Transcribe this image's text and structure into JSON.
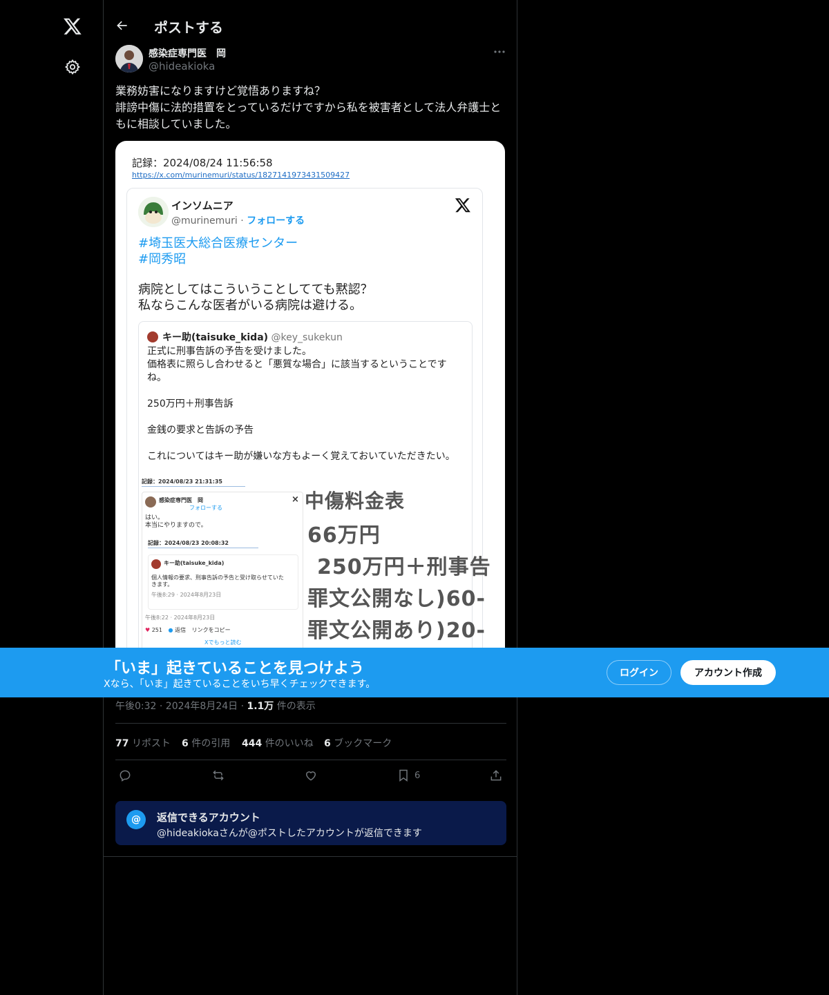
{
  "header": {
    "title": "ポストする"
  },
  "author": {
    "name": "感染症専門医　岡",
    "handle": "@hideakioka"
  },
  "tweet": {
    "text": "業務妨害になりますけど覚悟ありますね？\n誹謗中傷に法的措置をとっているだけですから私を被害者として法人弁護士ともに相談していました。"
  },
  "media": {
    "record": "記録：2024/08/24 11:56:58",
    "link": "https://x.com/murinemuri/status/1827141973431509427",
    "embed": {
      "name": "インソムニア",
      "handle": "@murinemuri",
      "follow": "フォローする",
      "tags": [
        "#埼玉医大総合医療センター",
        "#岡秀昭"
      ],
      "body": "病院としてはこういうことしてても黙認？\n私ならこんな医者がいる病院は避ける。",
      "quote": {
        "name": "キー助(taisuke_kida)",
        "handle": "@key_sukekun",
        "lines": "正式に刑事告訴の予告を受けました。\n価格表に照らし合わせると「悪質な場合」に該当するということです\nね。\n\n250万円＋刑事告訴\n\n金銭の要求と告訴の予告\n\nこれについてはキー助が嫌いな方もよーく覚えておいていただきたい。",
        "nested": {
          "record1": "記録：2024/08/23 21:31:35",
          "name": "感染症専門医　岡",
          "follow": "フォローする",
          "reply": "はい。\n本当にやりますので。",
          "record2": "記録：2024/08/23 20:08:32",
          "name2": "キー助(taisuke_kida)",
          "text2": "個人情報の要求、刑事告訴の予告と受け取らせていた\nきます。",
          "time2": "午後8:29 · 2024年8月23日",
          "time3": "午後8:22 · 2024年8月23日",
          "copy": "リンクをコピー",
          "more": "Xでもっと読む",
          "count": "251",
          "reply_label": "返信"
        },
        "price_lines": [
          "中傷料金表",
          "66万円",
          "250万円＋刑事告",
          "罪文公開なし)60-",
          "罪文公開あり)20-"
        ]
      }
    }
  },
  "banner": {
    "title": "「いま」起きていることを見つけよう",
    "subtitle": "Xなら、「いま」起きていることをいち早くチェックできます。",
    "login": "ログイン",
    "signup": "アカウント作成"
  },
  "meta": {
    "time": "午後0:32 · 2024年8月24日",
    "views_num": "1.1万",
    "views_label": "件の表示"
  },
  "stats": [
    {
      "num": "77",
      "label": "リポスト"
    },
    {
      "num": "6",
      "label": "件の引用"
    },
    {
      "num": "444",
      "label": "件のいいね"
    },
    {
      "num": "6",
      "label": "ブックマーク"
    }
  ],
  "actions": {
    "bookmark_count": "6"
  },
  "reply_info": {
    "title": "返信できるアカウント",
    "text": "@hideakiokaさんが@ポストしたアカウントが返信できます"
  },
  "colors": {
    "accent": "#1d9bf0",
    "background": "#000000",
    "muted": "#71767b"
  }
}
